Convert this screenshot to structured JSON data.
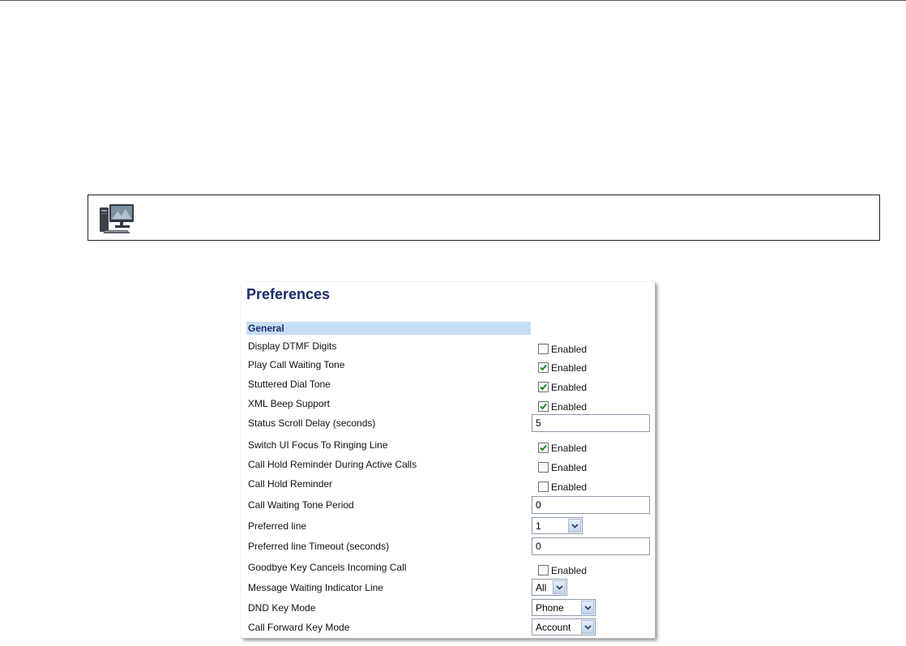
{
  "panel": {
    "title": "Preferences",
    "section": "General",
    "rows": [
      {
        "label": "Display DTMF Digits",
        "control": "checkbox",
        "checked": false,
        "text": "Enabled"
      },
      {
        "label": "Play Call Waiting Tone",
        "control": "checkbox",
        "checked": true,
        "text": "Enabled"
      },
      {
        "label": "Stuttered Dial Tone",
        "control": "checkbox",
        "checked": true,
        "text": "Enabled"
      },
      {
        "label": "XML Beep Support",
        "control": "checkbox",
        "checked": true,
        "text": "Enabled"
      },
      {
        "label": "Status Scroll Delay (seconds)",
        "control": "input",
        "value": "5"
      },
      {
        "label": "Switch UI Focus To Ringing Line",
        "control": "checkbox",
        "checked": true,
        "text": "Enabled"
      },
      {
        "label": "Call Hold Reminder During Active Calls",
        "control": "checkbox",
        "checked": false,
        "text": "Enabled"
      },
      {
        "label": "Call Hold Reminder",
        "control": "checkbox",
        "checked": false,
        "text": "Enabled"
      },
      {
        "label": "Call Waiting Tone Period",
        "control": "input",
        "value": "0"
      },
      {
        "label": "Preferred line",
        "control": "select",
        "value": "1"
      },
      {
        "label": "Preferred line Timeout (seconds)",
        "control": "input",
        "value": "0"
      },
      {
        "label": "Goodbye Key Cancels Incoming Call",
        "control": "checkbox",
        "checked": false,
        "text": "Enabled"
      },
      {
        "label": "Message Waiting Indicator Line",
        "control": "select",
        "value": "All"
      },
      {
        "label": "DND Key Mode",
        "control": "select",
        "value": "Phone"
      },
      {
        "label": "Call Forward Key Mode",
        "control": "select",
        "value": "Account"
      }
    ]
  },
  "icons": {
    "note": "computer-monitor-icon",
    "checkmark": "checkmark-icon",
    "dropdown": "chevron-down-icon"
  },
  "colors": {
    "title": "#1a2c6b",
    "section_bg": "#c5def5",
    "check": "#1d8a1d"
  }
}
